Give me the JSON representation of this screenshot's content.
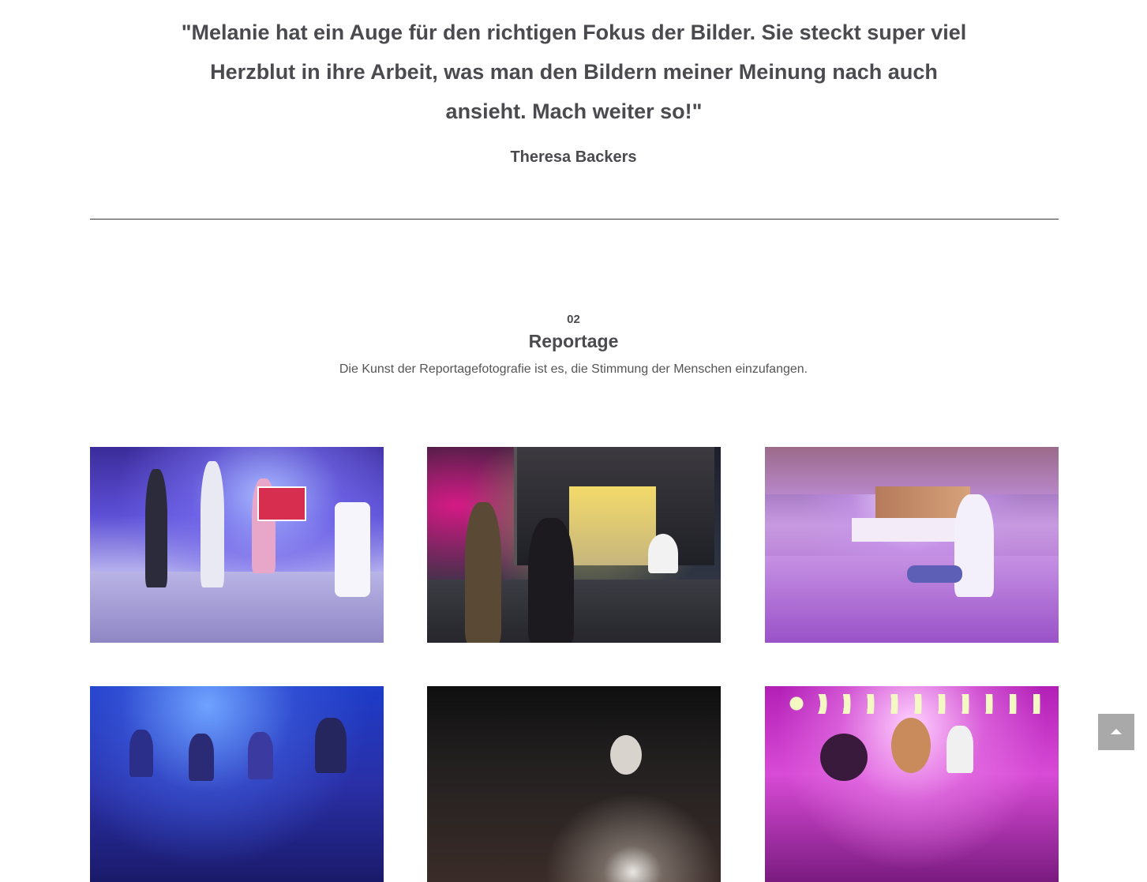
{
  "testimonial": {
    "quote": "\"Melanie hat ein Auge für den richtigen Fokus der Bilder. Sie steckt super viel Herzblut in ihre Arbeit, was man den Bildern meiner Meinung nach auch ansieht. Mach weiter so!\"",
    "author": "Theresa Backers"
  },
  "section": {
    "number": "02",
    "title": "Reportage",
    "description": "Die Kunst der Reportagefotografie ist es, die Stimmung der Menschen einzufangen."
  },
  "gallery": {
    "photos": [
      {
        "scene": "dance-floor-blue"
      },
      {
        "scene": "night-street-red"
      },
      {
        "scene": "hall-purple"
      },
      {
        "scene": "party-blue"
      },
      {
        "scene": "dark-brick"
      },
      {
        "scene": "hall-magenta"
      }
    ]
  },
  "controls": {
    "scroll_top_icon": "triangle-up-icon",
    "scroll_top_bg": "#a9a9a9"
  }
}
